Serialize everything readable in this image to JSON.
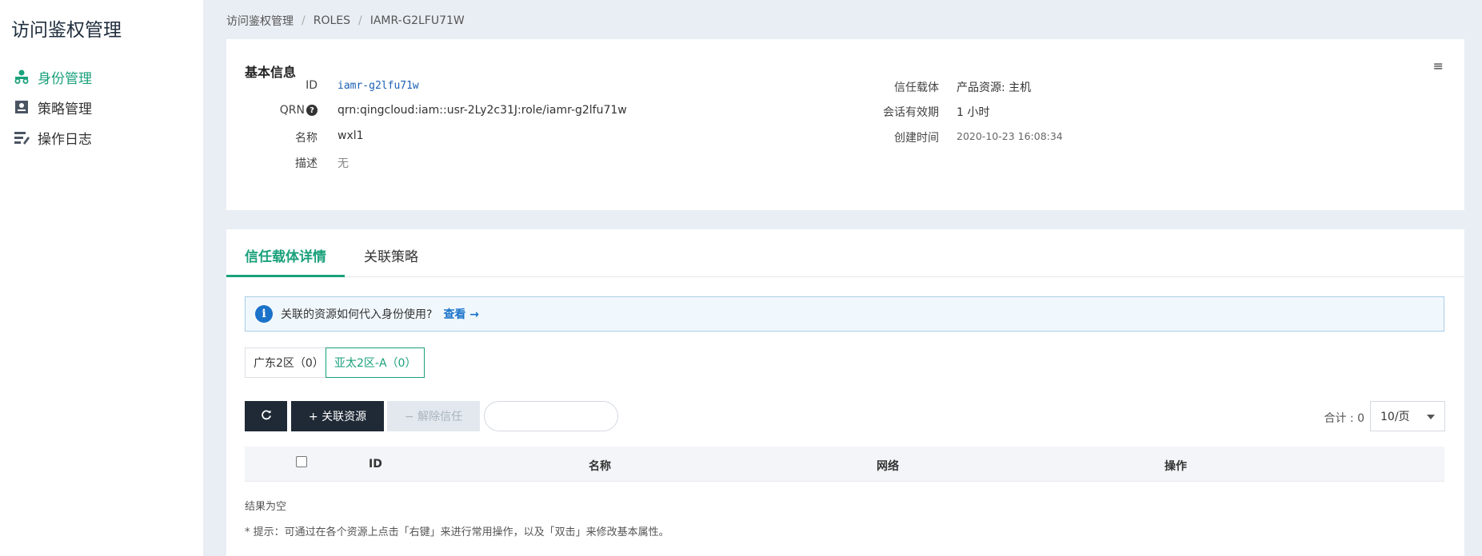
{
  "sidebar": {
    "title": "访问鉴权管理",
    "items": [
      {
        "label": "身份管理",
        "icon": "identity-icon",
        "active": true
      },
      {
        "label": "策略管理",
        "icon": "policy-icon",
        "active": false
      },
      {
        "label": "操作日志",
        "icon": "log-icon",
        "active": false
      }
    ]
  },
  "breadcrumb": [
    "访问鉴权管理",
    "ROLES",
    "IAMR-G2LFU71W"
  ],
  "basic_info": {
    "title": "基本信息",
    "id_label": "ID",
    "id_value": "iamr-g2lfu71w",
    "qrn_label": "QRN",
    "qrn_value": "qrn:qingcloud:iam::usr-2Ly2c31J:role/iamr-g2lfu71w",
    "name_label": "名称",
    "name_value": "wxl1",
    "desc_label": "描述",
    "desc_value": "无",
    "trust_label": "信任载体",
    "trust_value": "产品资源: 主机",
    "session_label": "会话有效期",
    "session_value": "1 小时",
    "created_label": "创建时间",
    "created_value": "2020-10-23 16:08:34"
  },
  "tabs": [
    {
      "label": "信任载体详情",
      "active": true
    },
    {
      "label": "关联策略",
      "active": false
    }
  ],
  "info_bar": {
    "text": "关联的资源如何代入身份使用?",
    "link": "查看 →"
  },
  "zones": [
    {
      "label": "广东2区（0）",
      "active": false
    },
    {
      "label": "亚太2区-A（0）",
      "active": true
    }
  ],
  "toolbar": {
    "refresh_icon": "refresh-icon",
    "add_label": "+  关联资源",
    "remove_label": "−  解除信任",
    "search_placeholder": "",
    "total_label": "合计 : 0",
    "page_size": "10/页"
  },
  "table": {
    "columns": [
      "ID",
      "名称",
      "网络",
      "操作"
    ],
    "empty_text": "结果为空"
  },
  "hint": "* 提示：可通过在各个资源上点击「右键」来进行常用操作，以及「双击」来修改基本属性。",
  "colors": {
    "accent": "#1aa17b",
    "dark_button": "#1f2a36",
    "link": "#1a73c9",
    "background": "#e9eef4"
  }
}
